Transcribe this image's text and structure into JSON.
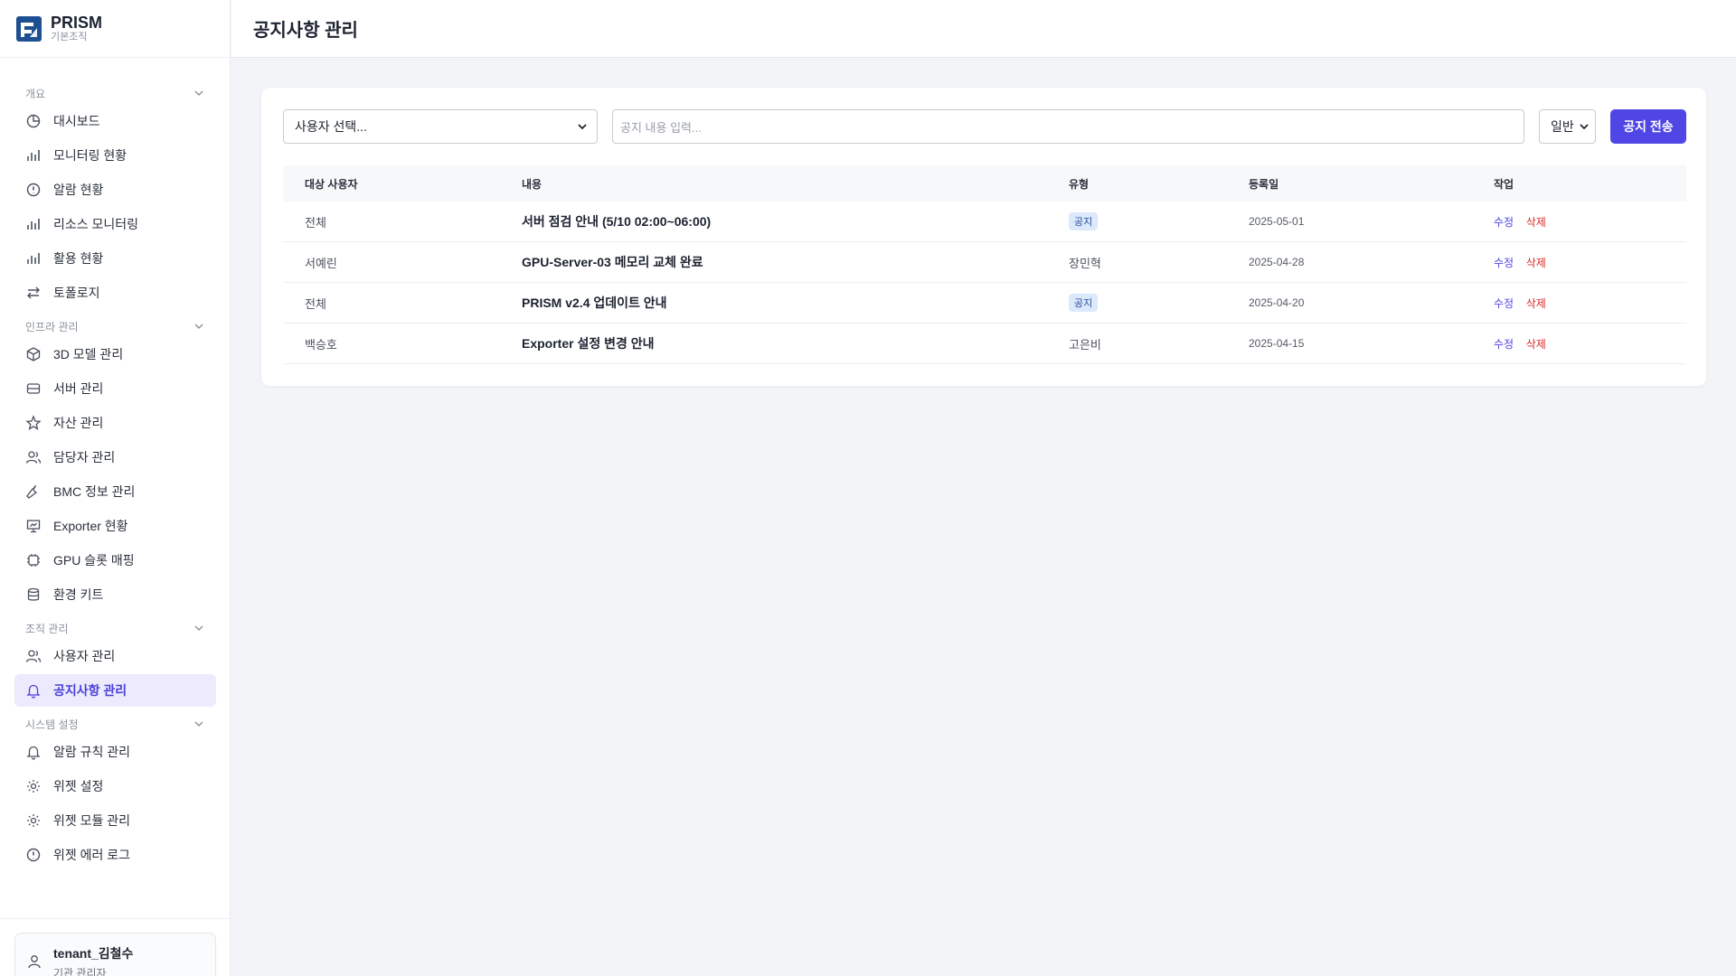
{
  "brand": {
    "name": "PRISM",
    "subtitle": "기본조직"
  },
  "sidebar": {
    "groups": [
      {
        "title": "개요",
        "items": [
          "대시보드",
          "모니터링 현황",
          "알람 현황",
          "리소스 모니터링",
          "활용 현황",
          "토폴로지"
        ]
      },
      {
        "title": "인프라 관리",
        "items": [
          "3D 모델 관리",
          "서버 관리",
          "자산 관리",
          "담당자 관리",
          "BMC 정보 관리",
          "Exporter 현황",
          "GPU 슬롯 매핑",
          "환경 키트"
        ]
      },
      {
        "title": "조직 관리",
        "items": [
          "사용자 관리",
          "공지사항 관리"
        ]
      },
      {
        "title": "시스템 설정",
        "items": [
          "알람 규칙 관리",
          "위젯 설정",
          "위젯 모듈 관리",
          "위젯 에러 로그"
        ]
      }
    ],
    "active_item": "공지사항 관리",
    "user": {
      "name": "tenant_김철수",
      "role": "기관 관리자"
    }
  },
  "header": {
    "title": "공지사항 관리"
  },
  "toolbar": {
    "user_select": "사용자 선택...",
    "content_placeholder": "공지 내용 입력...",
    "type_select": "일반",
    "send_label": "공지 전송"
  },
  "table": {
    "headers": [
      "대상 사용자",
      "내용",
      "유형",
      "등록일",
      "작업"
    ],
    "rows": [
      {
        "target": "전체",
        "content": "서버 점검 안내 (5/10 02:00~06:00)",
        "type": "공지",
        "type_is_badge": true,
        "date": "2025-05-01",
        "edit": "수정",
        "delete": "삭제"
      },
      {
        "target": "서예린",
        "content": "GPU-Server-03 메모리 교체 완료",
        "type": "장민혁",
        "type_is_badge": false,
        "date": "2025-04-28",
        "edit": "수정",
        "delete": "삭제"
      },
      {
        "target": "전체",
        "content": "PRISM v2.4 업데이트 안내",
        "type": "공지",
        "type_is_badge": true,
        "date": "2025-04-20",
        "edit": "수정",
        "delete": "삭제"
      },
      {
        "target": "백승호",
        "content": "Exporter 설정 변경 안내",
        "type": "고은비",
        "type_is_badge": false,
        "date": "2025-04-15",
        "edit": "수정",
        "delete": "삭제"
      }
    ]
  },
  "colors": {
    "accent": "#4f46e5",
    "danger": "#dc2626",
    "badge_bg": "#dce8fb"
  }
}
